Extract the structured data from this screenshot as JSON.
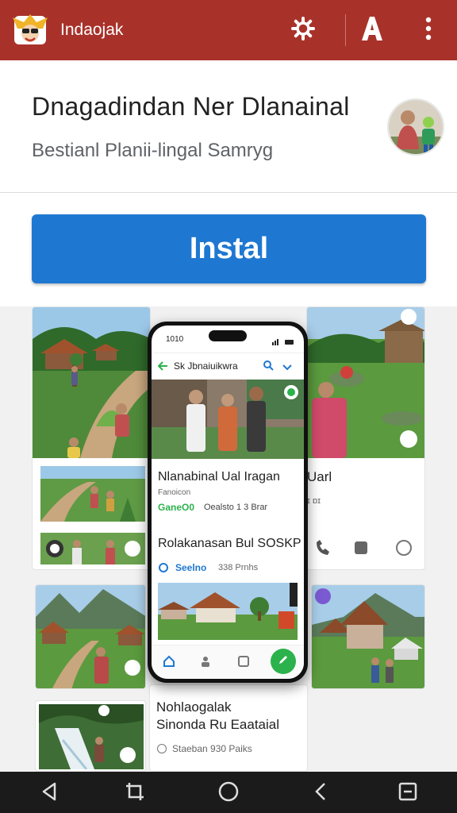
{
  "app_bar": {
    "app_name": "Indaojak",
    "icons": [
      "logo-icon",
      "settings-icon",
      "text-style-icon",
      "overflow-menu-icon"
    ]
  },
  "listing": {
    "title": "Dnagadindan Ner Dlanainal",
    "subtitle": "Bestianl Planii-lingal  Samryg",
    "install_label": "Instal"
  },
  "screenshots": {
    "left_bottom_text": {
      "line1": "Nohlaogalak",
      "line2": "Sinonda Ru Eaataial",
      "meta": "Staeban  930 Paiks"
    },
    "right_text": "Uarl",
    "phone": {
      "time": "1010",
      "search_title": "Sk Jbnaiuikwra",
      "item1_title": "Nlanabinal Ual Iragan",
      "item1_sub": "Fanoicon",
      "item1_meta_tag": "GaneO0",
      "item1_meta": "Oealsto 1 3 Brar",
      "item2_title": "Rolakanasan Bul SOSKP",
      "item2_tag": "Seelno",
      "item2_meta": "338 Prnhs"
    }
  },
  "nav_bar": {
    "icons": [
      "back-triangle-icon",
      "screenshot-icon",
      "home-circle-icon",
      "back-chevron-icon",
      "recents-square-icon"
    ]
  },
  "colors": {
    "app_bar": "#a8322a",
    "install": "#1e78d2",
    "nav_bar": "#1b1b1b",
    "accent_green": "#2bb24c"
  }
}
